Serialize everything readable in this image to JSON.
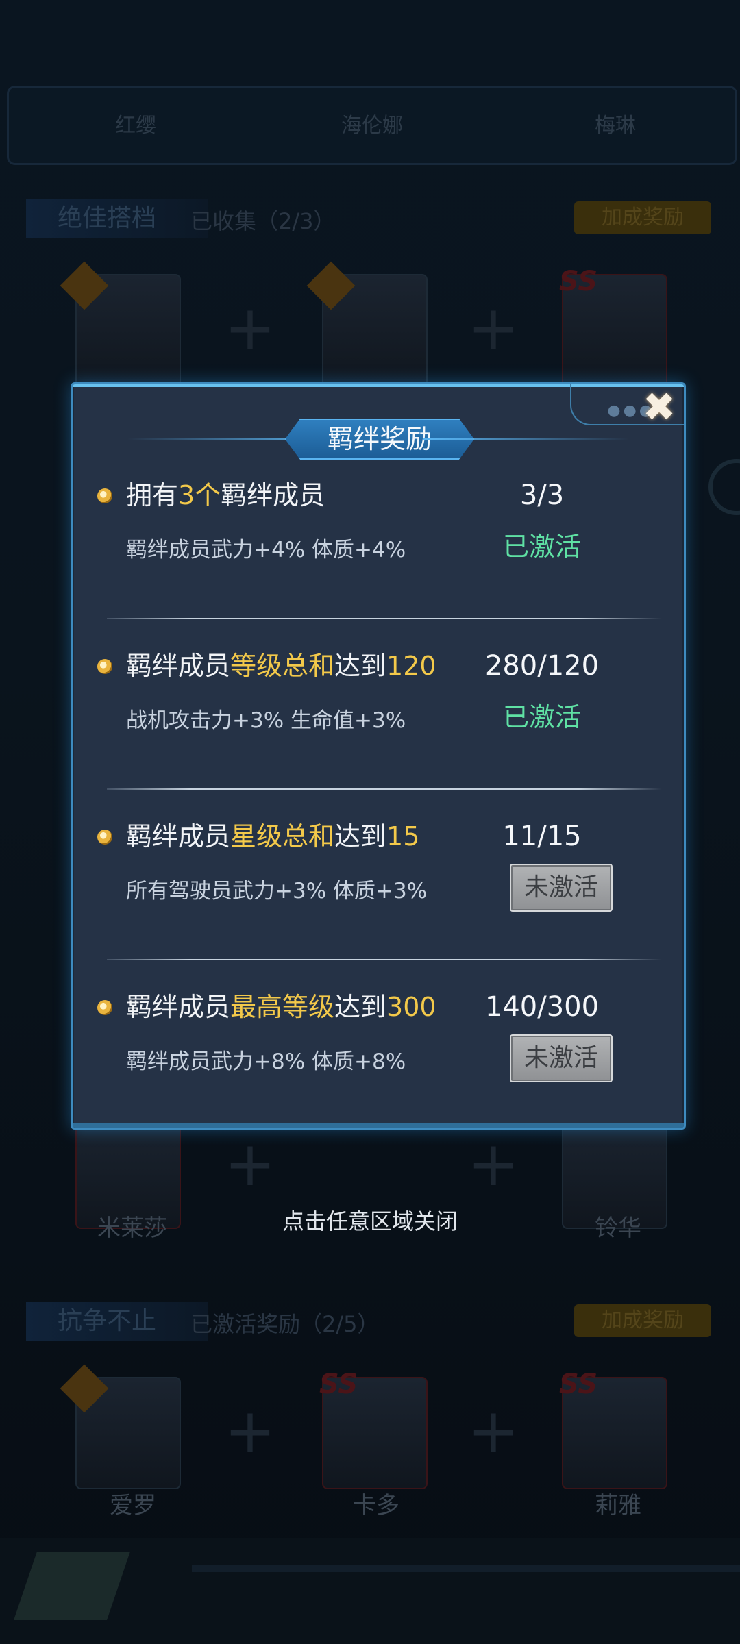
{
  "background": {
    "tabs": [
      "红缨",
      "海伦娜",
      "梅琳"
    ],
    "section1": {
      "title": "绝佳搭档",
      "subtitle": "已收集（2/3）",
      "button": "加成奖励"
    },
    "section2": {
      "title": "抗争不止",
      "subtitle": "已激活奖励（2/5）",
      "button": "加成奖励"
    },
    "names_row3": [
      "米莱莎",
      "铃华"
    ],
    "names_row4": [
      "爱罗",
      "卡多",
      "莉雅"
    ]
  },
  "modal": {
    "title": "羁绊奖励",
    "close_icon": "close-icon",
    "rows": [
      {
        "title_parts": [
          [
            "拥有",
            false
          ],
          [
            "3个",
            true
          ],
          [
            "羁绊成员",
            false
          ]
        ],
        "progress": "3/3",
        "desc": "羁绊成员武力+4%  体质+4%",
        "status": "已激活",
        "active": true
      },
      {
        "title_parts": [
          [
            "羁绊成员",
            false
          ],
          [
            "等级总和",
            true
          ],
          [
            "达到",
            false
          ],
          [
            "120",
            true
          ]
        ],
        "progress": "280/120",
        "desc": "战机攻击力+3%  生命值+3%",
        "status": "已激活",
        "active": true
      },
      {
        "title_parts": [
          [
            "羁绊成员",
            false
          ],
          [
            "星级总和",
            true
          ],
          [
            "达到",
            false
          ],
          [
            "15",
            true
          ]
        ],
        "progress": "11/15",
        "desc": "所有驾驶员武力+3%  体质+3%",
        "status": "未激活",
        "active": false
      },
      {
        "title_parts": [
          [
            "羁绊成员",
            false
          ],
          [
            "最高等级",
            true
          ],
          [
            "达到",
            false
          ],
          [
            "300",
            true
          ]
        ],
        "progress": "140/300",
        "desc": "羁绊成员武力+8%  体质+8%",
        "status": "未激活",
        "active": false
      }
    ]
  },
  "hint": "点击任意区域关闭",
  "colors": {
    "highlight": "#f3c94a",
    "active": "#5fe1a4",
    "modal_bg": "#253246",
    "border": "#3e8bbf"
  }
}
